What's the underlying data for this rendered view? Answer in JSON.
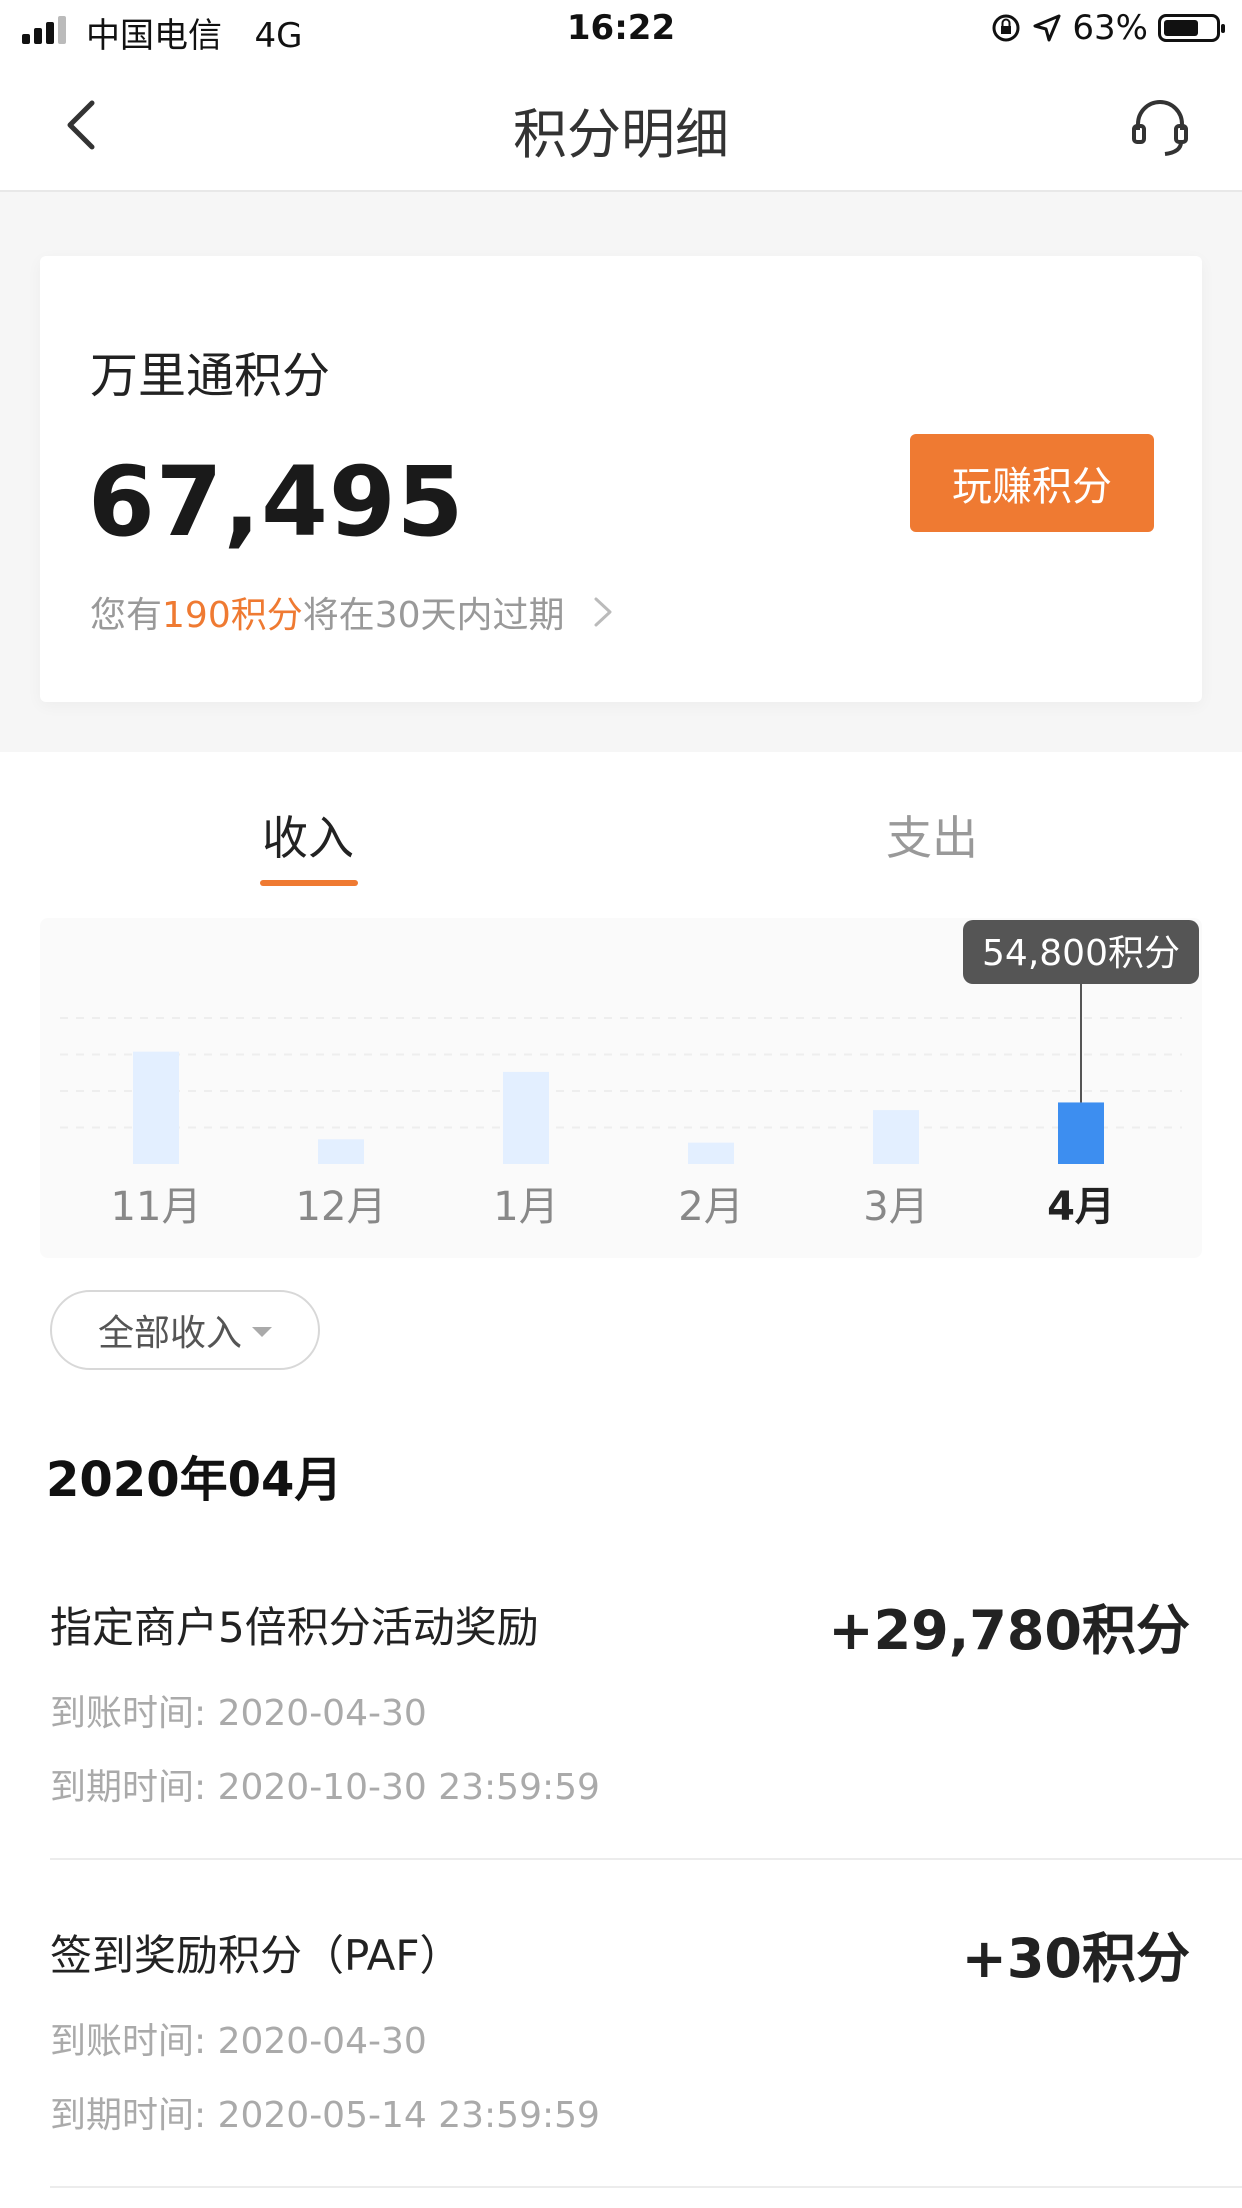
{
  "status_bar": {
    "carrier": "中国电信",
    "network": "4G",
    "time": "16:22",
    "battery": "63%"
  },
  "nav": {
    "title": "积分明细"
  },
  "points_card": {
    "label": "万里通积分",
    "amount": "67,495",
    "earn_button": "玩赚积分",
    "expire_prefix": "您有",
    "expire_highlight": "190积分",
    "expire_suffix": "将在30天内过期"
  },
  "tabs": [
    {
      "label": "收入",
      "active": true
    },
    {
      "label": "支出",
      "active": false
    }
  ],
  "chart_data": {
    "type": "bar",
    "categories": [
      "11月",
      "12月",
      "1月",
      "2月",
      "3月",
      "4月"
    ],
    "values": [
      100000,
      22000,
      82000,
      19000,
      48000,
      54800
    ],
    "selected_index": 5,
    "tooltip": "54,800积分",
    "ylim": [
      0,
      130000
    ],
    "colors": {
      "bar": "#e3efff",
      "selected": "#3d8ef0",
      "tooltip_bg": "#555555"
    },
    "grid": true
  },
  "filter": {
    "label": "全部收入"
  },
  "month_header": "2020年04月",
  "records": [
    {
      "name": "指定商户5倍积分活动奖励",
      "points": "+29,780积分",
      "arrival": "到账时间: 2020-04-30",
      "expiry": "到期时间: 2020-10-30 23:59:59"
    },
    {
      "name": "签到奖励积分（PAF）",
      "points": "+30积分",
      "arrival": "到账时间: 2020-04-30",
      "expiry": "到期时间: 2020-05-14 23:59:59"
    }
  ]
}
